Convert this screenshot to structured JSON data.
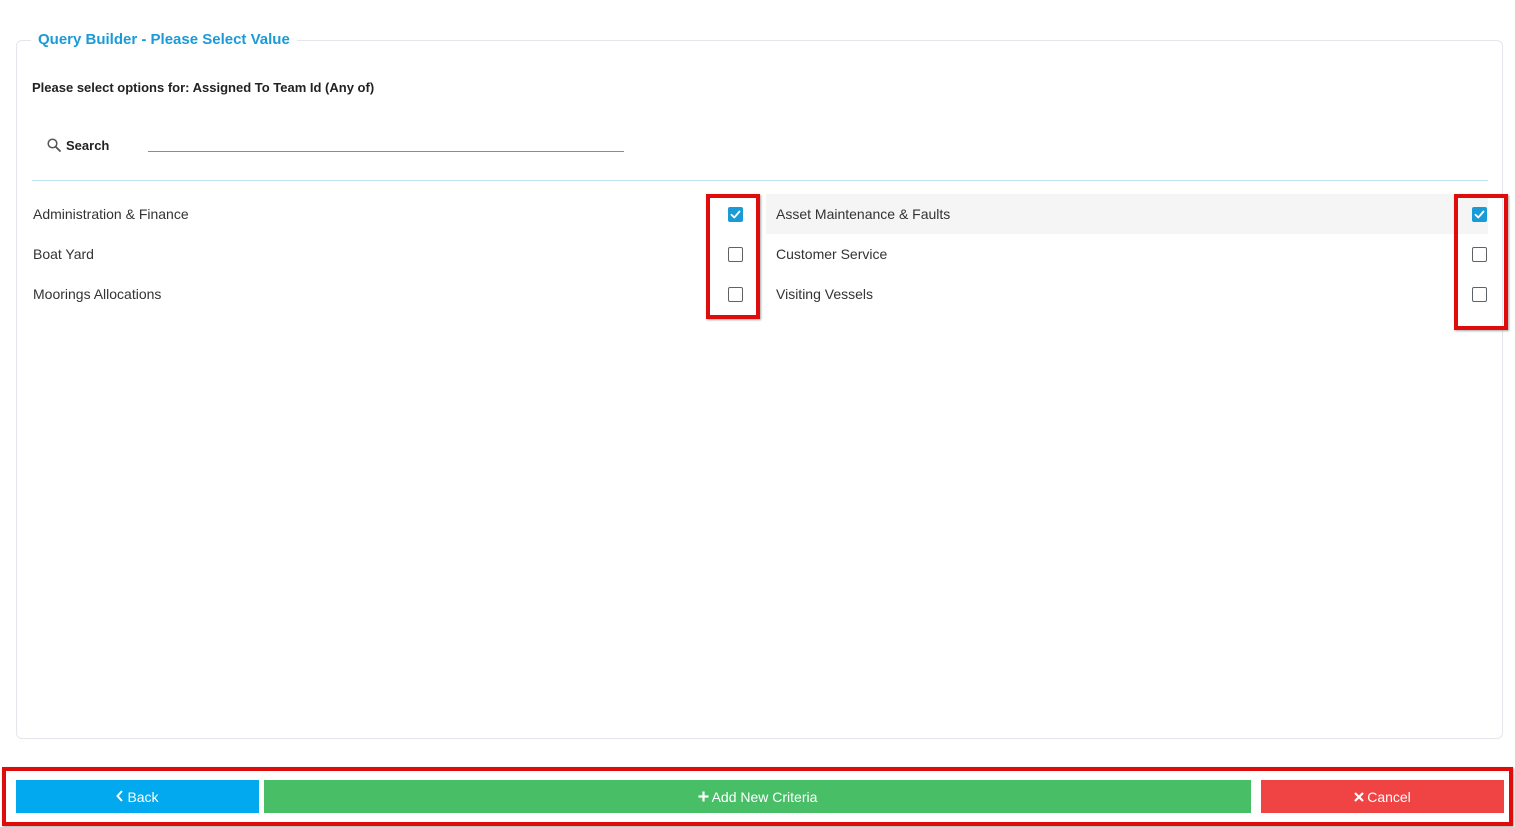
{
  "panel": {
    "title": "Query Builder - Please Select Value",
    "prompt": "Please select options for: Assigned To Team Id (Any of)"
  },
  "search": {
    "label": "Search",
    "value": "",
    "placeholder": ""
  },
  "options": {
    "left": [
      {
        "label": "Administration & Finance",
        "checked": true
      },
      {
        "label": "Boat Yard",
        "checked": false
      },
      {
        "label": "Moorings Allocations",
        "checked": false
      }
    ],
    "right": [
      {
        "label": "Asset Maintenance & Faults",
        "checked": true
      },
      {
        "label": "Customer Service",
        "checked": false
      },
      {
        "label": "Visiting Vessels",
        "checked": false
      }
    ]
  },
  "footer": {
    "back_label": "Back",
    "add_label": "Add New Criteria",
    "cancel_label": "Cancel"
  },
  "colors": {
    "accent": "#1a9bd7",
    "back_button": "#03a9ef",
    "add_button": "#48bf67",
    "cancel_button": "#f04444",
    "highlight": "#e00b0b"
  },
  "icons": {
    "search": "search-icon",
    "back": "chevron-left-icon",
    "add": "plus-icon",
    "cancel": "close-icon",
    "check": "check-icon"
  }
}
